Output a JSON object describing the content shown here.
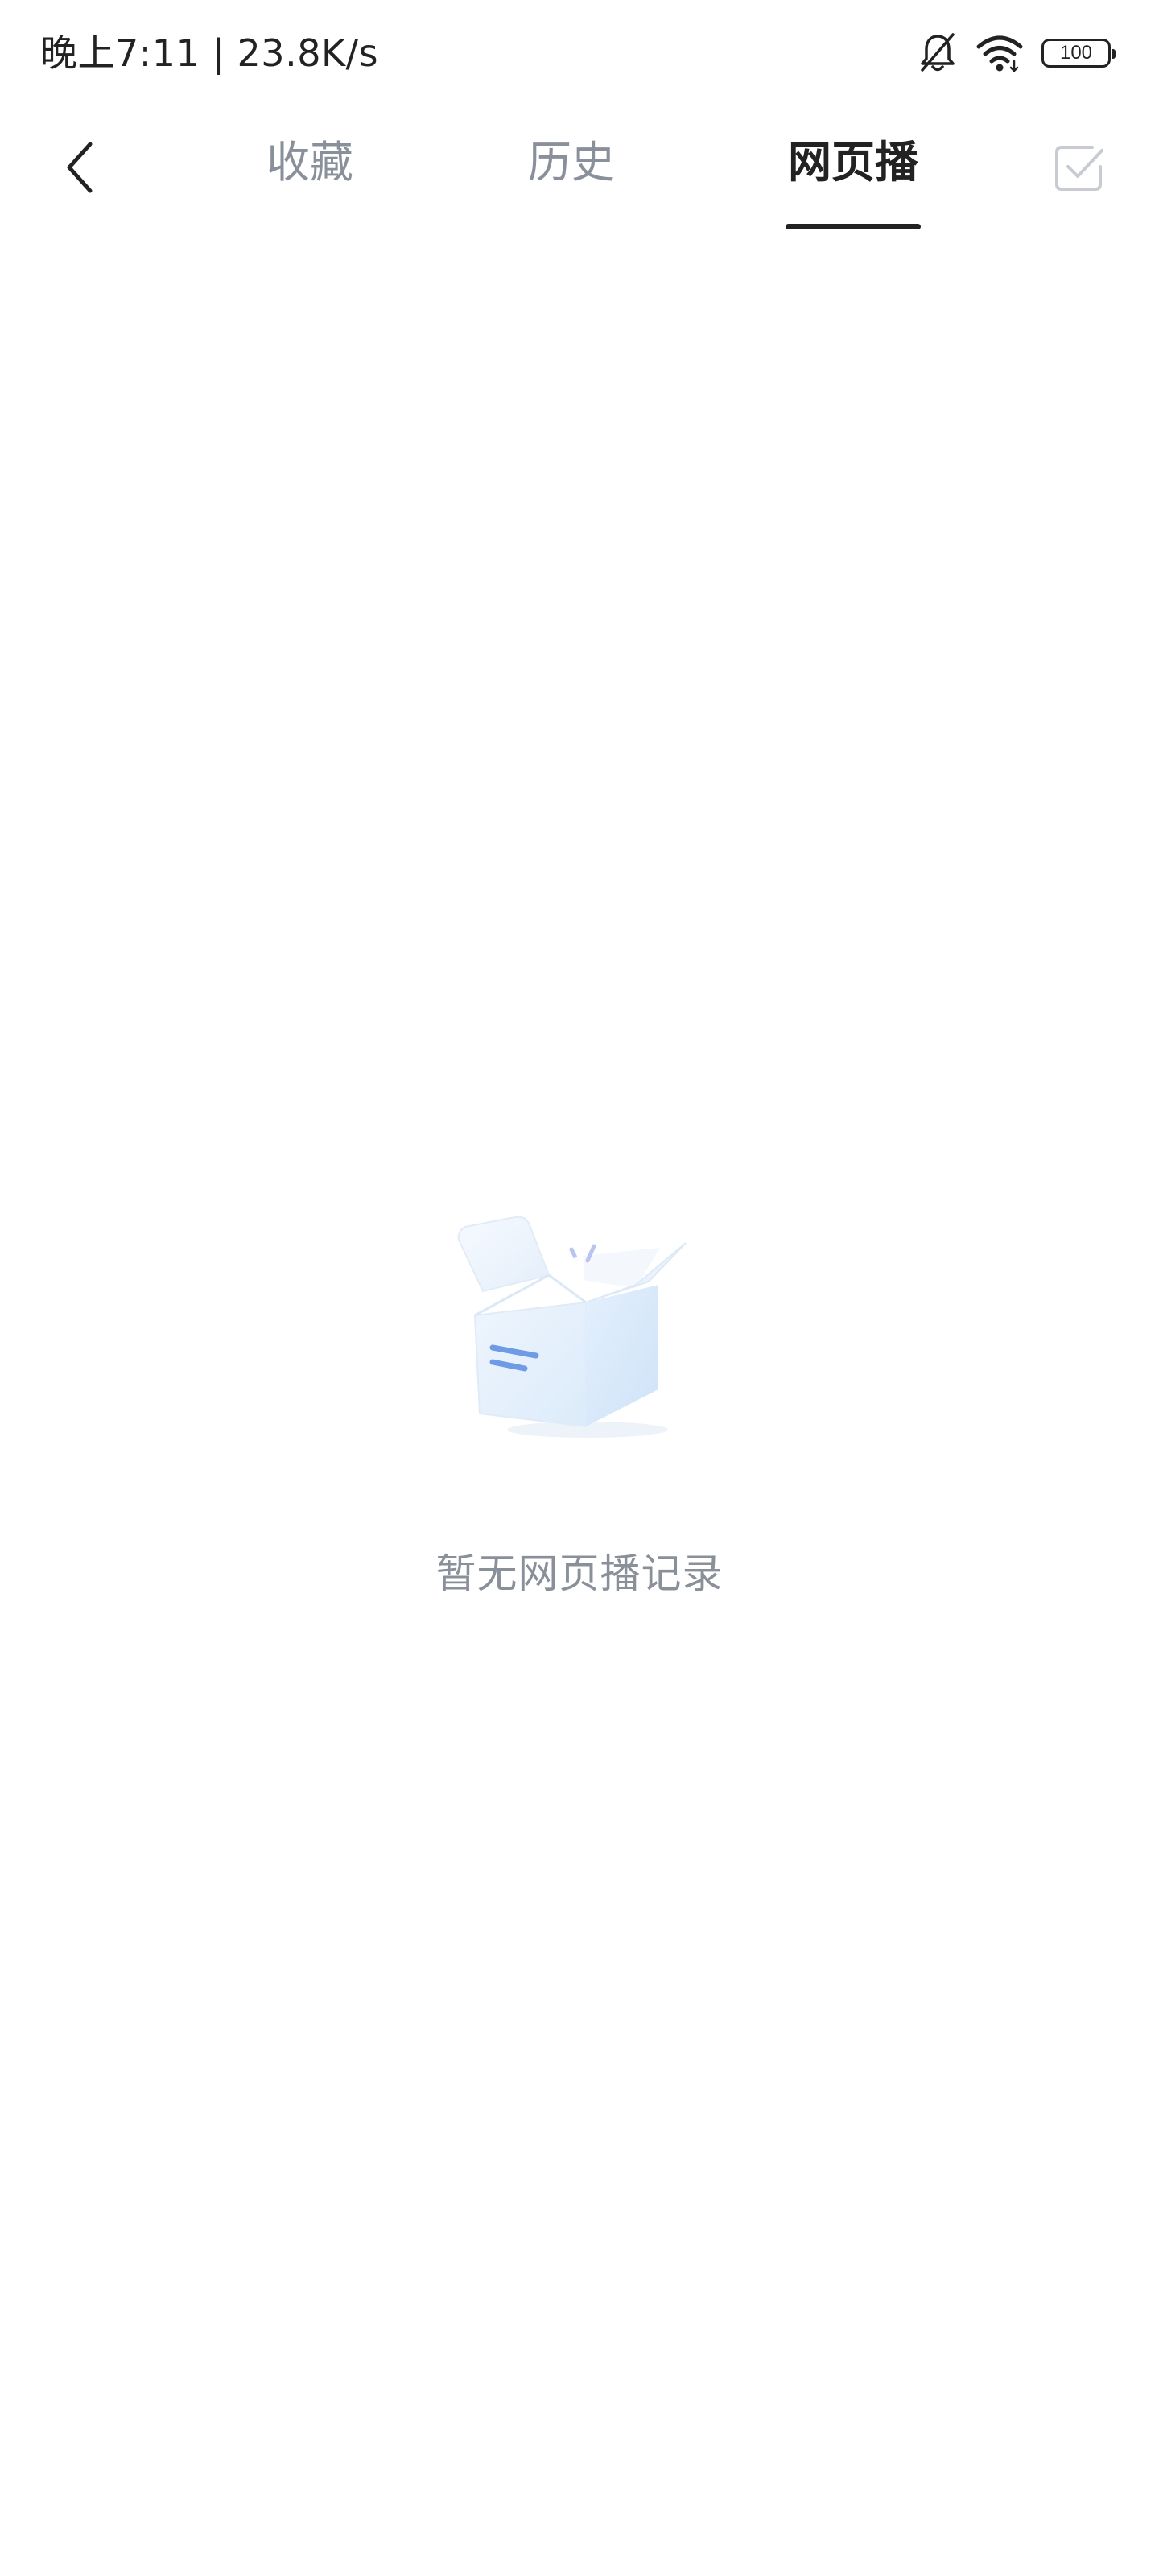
{
  "status_bar": {
    "text": "晚上7:11 | 23.8K/s",
    "battery_level": "100",
    "icons": [
      "bell-muted-icon",
      "wifi-icon",
      "battery-icon"
    ]
  },
  "header": {
    "back_icon": "chevron-left-icon",
    "tabs": [
      {
        "label": "收藏",
        "active": false
      },
      {
        "label": "历史",
        "active": false
      },
      {
        "label": "网页播",
        "active": true
      }
    ],
    "select_icon": "checkbox-check-icon"
  },
  "empty_state": {
    "illustration": "open-box-icon",
    "message": "暂无网页播记录"
  },
  "colors": {
    "active_tab": "#222222",
    "inactive_tab": "#8a909a",
    "empty_text": "#8a909a",
    "box_accent": "#6f9be6"
  }
}
